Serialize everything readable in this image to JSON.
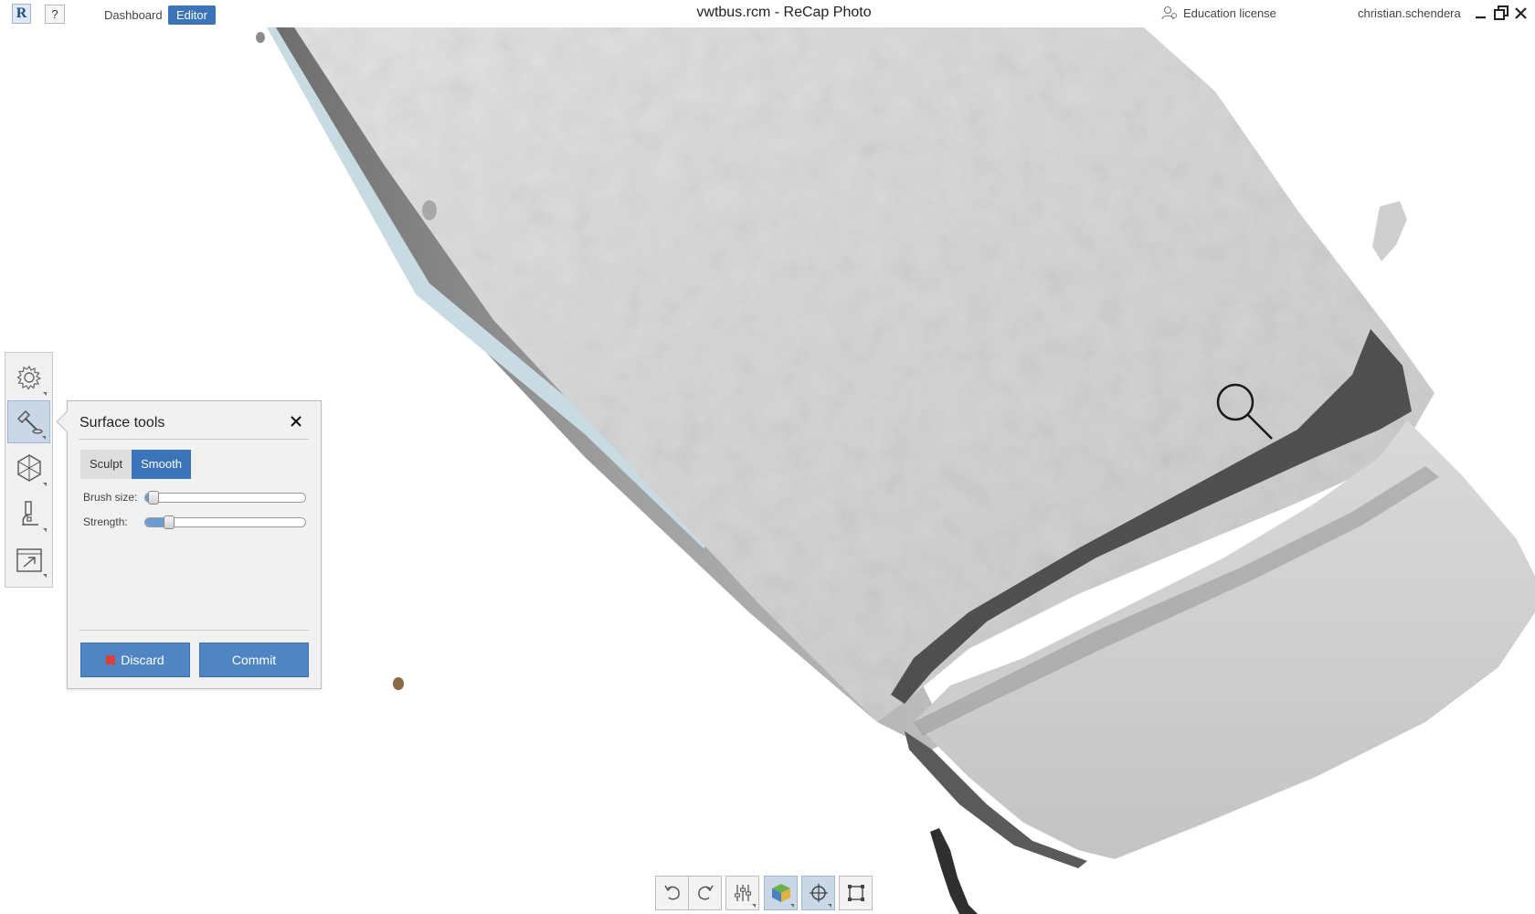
{
  "titlebar": {
    "logo_letter": "R",
    "help_label": "?",
    "nav": {
      "dashboard": "Dashboard",
      "editor": "Editor"
    },
    "window_title": "vwtbus.rcm - ReCap Photo",
    "license": "Education license",
    "username": "christian.schendera",
    "controls": [
      "minimize-icon",
      "restore-icon",
      "close-icon"
    ]
  },
  "left_toolbar": {
    "tools": [
      {
        "name": "settings",
        "icon": "gear-icon",
        "active": false
      },
      {
        "name": "surface-tools",
        "icon": "hammer-icon",
        "active": true
      },
      {
        "name": "mesh-tools",
        "icon": "mesh-icon",
        "active": false
      },
      {
        "name": "analysis",
        "icon": "microscope-icon",
        "active": false
      },
      {
        "name": "export",
        "icon": "export-icon",
        "active": false
      }
    ]
  },
  "surface_panel": {
    "title": "Surface tools",
    "modes": {
      "sculpt": "Sculpt",
      "smooth": "Smooth"
    },
    "selected_mode": "Smooth",
    "brush_size_label": "Brush size:",
    "brush_size_value": 0.02,
    "strength_label": "Strength:",
    "strength_value": 0.12,
    "discard_label": "Discard",
    "commit_label": "Commit"
  },
  "bottom_toolbar": {
    "buttons": [
      {
        "icon": "undo-icon",
        "active": false
      },
      {
        "icon": "redo-icon",
        "active": false
      },
      {
        "icon": "sliders-icon",
        "active": false
      },
      {
        "icon": "shaded-cube-icon",
        "active": true
      },
      {
        "icon": "pivot-target-icon",
        "active": true
      },
      {
        "icon": "crop-box-icon",
        "active": false
      }
    ]
  },
  "colors": {
    "accent": "#3b74b8",
    "mesh": "#d4d4d4",
    "background": "#ffffff"
  }
}
